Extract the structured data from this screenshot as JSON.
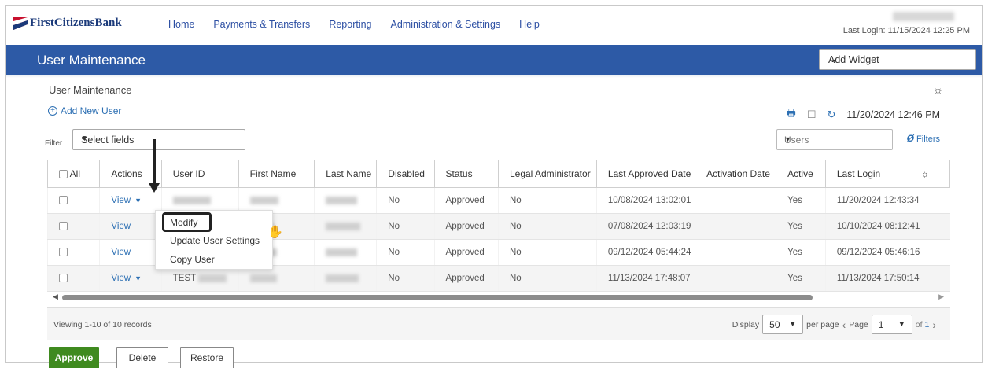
{
  "header": {
    "logo_text": "FirstCitizensBank",
    "nav": [
      "Home",
      "Payments & Transfers",
      "Reporting",
      "Administration & Settings",
      "Help"
    ],
    "last_login": "Last Login: 11/15/2024 12:25 PM"
  },
  "band": {
    "title": "User Maintenance",
    "widget_select": "Add Widget"
  },
  "content": {
    "section_title": "User Maintenance",
    "add_user": "Add New User",
    "timestamp": "11/20/2024 12:46 PM",
    "filter_label": "Filter",
    "filter_placeholder": "Select fields",
    "users_select": "Users",
    "filters_link": "Filters"
  },
  "table": {
    "columns": [
      "All",
      "Actions",
      "User ID",
      "First Name",
      "Last Name",
      "Disabled",
      "Status",
      "Legal Administrator",
      "Last Approved Date",
      "Activation Date",
      "Active",
      "Last Login"
    ],
    "rows": [
      {
        "action": "View",
        "user_id": "",
        "disabled": "No",
        "status": "Approved",
        "legal_admin": "No",
        "last_approved": "10/08/2024 13:02:01",
        "activation": "",
        "active": "Yes",
        "last_login": "11/20/2024 12:43:34"
      },
      {
        "action": "View",
        "user_id": "",
        "disabled": "No",
        "status": "Approved",
        "legal_admin": "No",
        "last_approved": "07/08/2024 12:03:19",
        "activation": "",
        "active": "Yes",
        "last_login": "10/10/2024 08:12:41"
      },
      {
        "action": "View",
        "user_id": "",
        "disabled": "No",
        "status": "Approved",
        "legal_admin": "No",
        "last_approved": "09/12/2024 05:44:24",
        "activation": "",
        "active": "Yes",
        "last_login": "09/12/2024 05:46:16"
      },
      {
        "action": "View",
        "user_id": "TEST",
        "disabled": "No",
        "status": "Approved",
        "legal_admin": "No",
        "last_approved": "11/13/2024 17:48:07",
        "activation": "",
        "active": "Yes",
        "last_login": "11/13/2024 17:50:14"
      }
    ]
  },
  "menu": {
    "items": [
      "Modify",
      "Update User Settings",
      "Copy User"
    ]
  },
  "footer": {
    "viewing": "Viewing 1-10 of 10 records",
    "display_label": "Display",
    "per_page_value": "50",
    "per_page_label": "per page",
    "page_label": "Page",
    "page_value": "1",
    "of_prefix": "of",
    "of_total": "1"
  },
  "buttons": {
    "approve": "Approve",
    "delete": "Delete",
    "restore": "Restore"
  },
  "colors": {
    "brand_blue": "#2d5aa6",
    "link_blue": "#2c6fb3",
    "approve_green": "#3f8a1f"
  }
}
